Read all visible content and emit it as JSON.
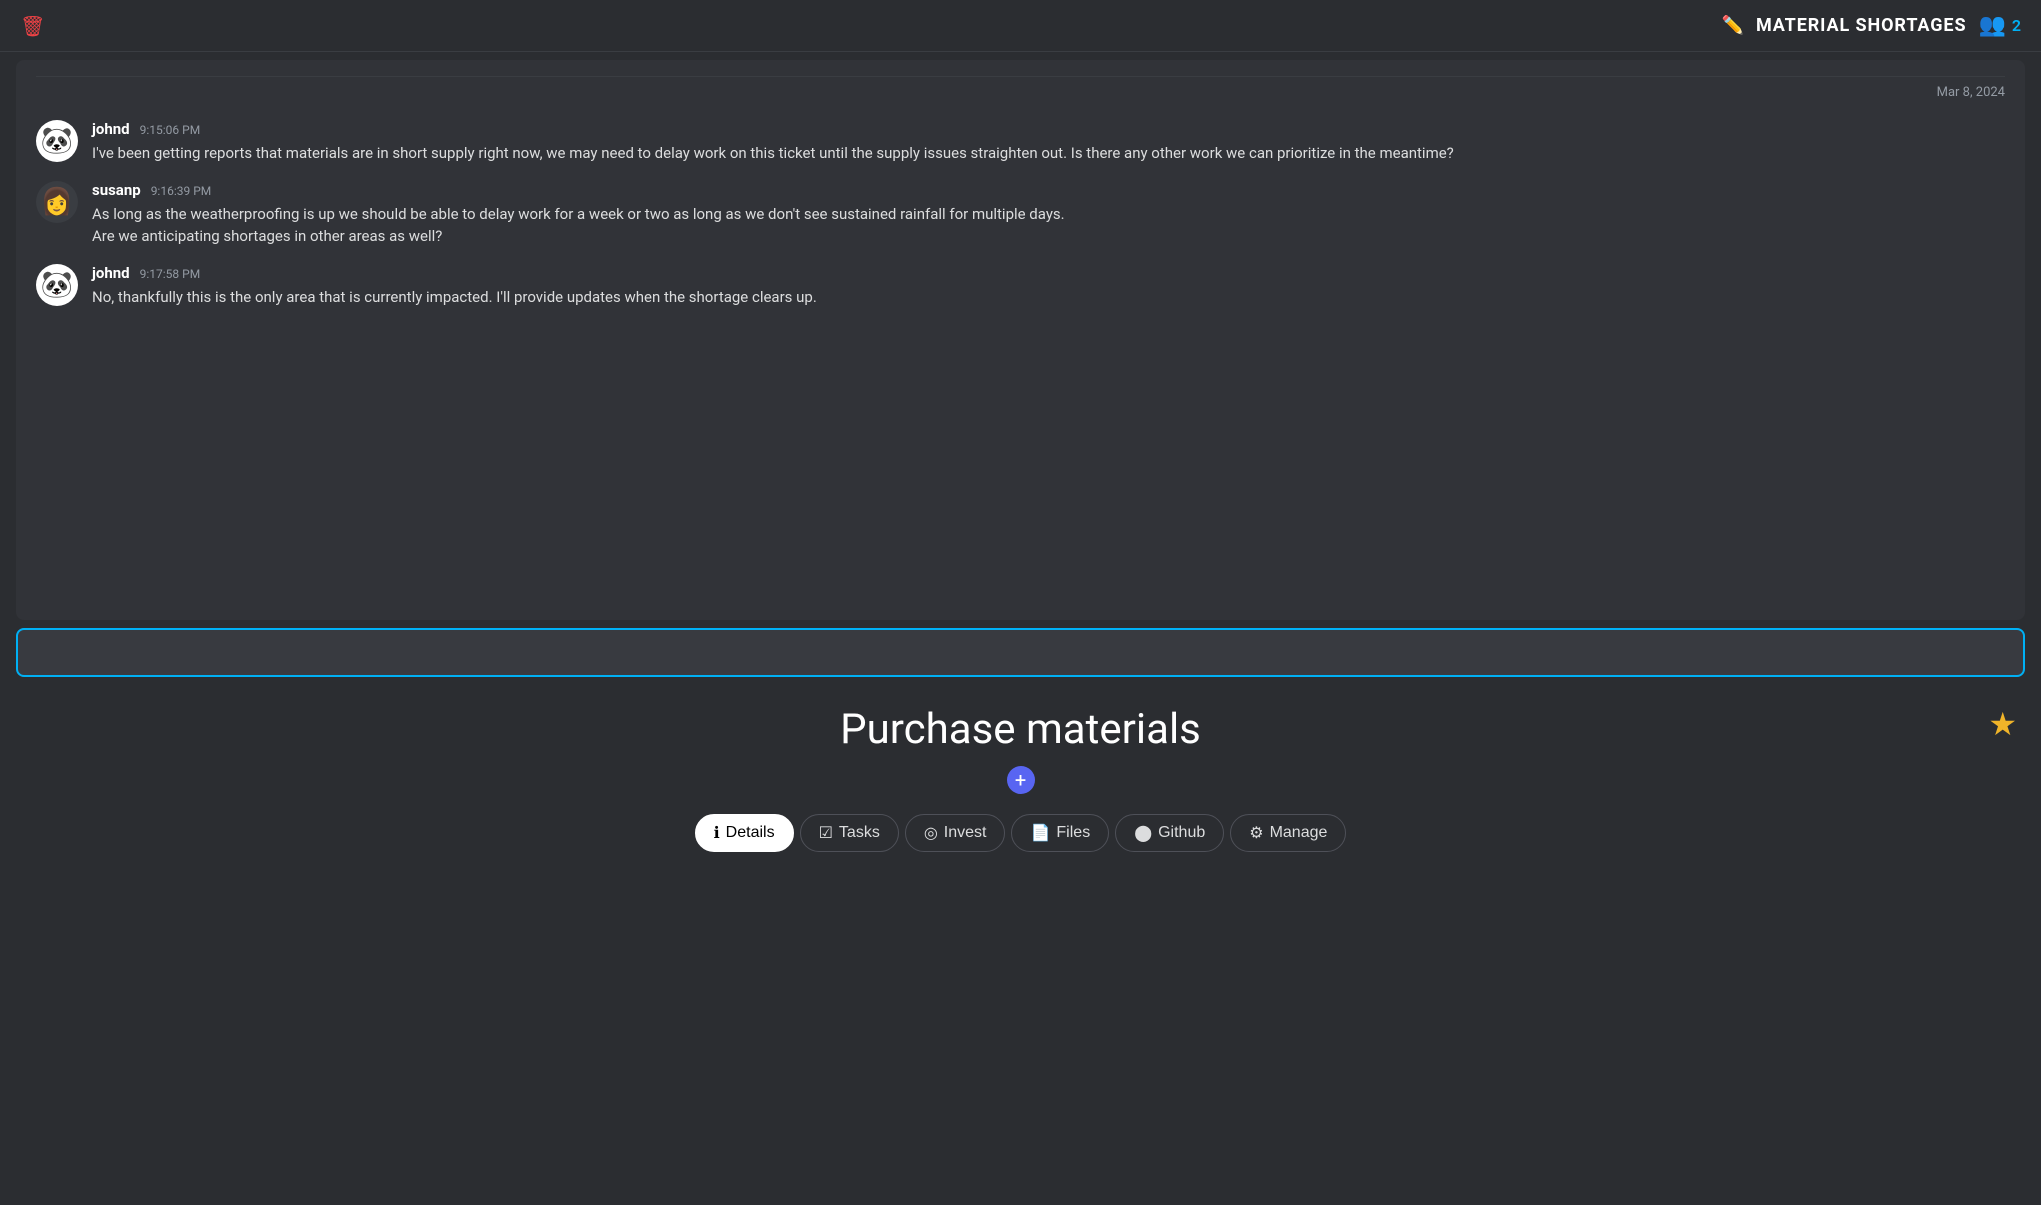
{
  "header": {
    "title": "MATERIAL SHORTAGES",
    "members_count": "2",
    "trash_label": "trash",
    "edit_label": "edit"
  },
  "chat": {
    "date": "Mar 8, 2024",
    "messages": [
      {
        "author": "johnd",
        "time": "9:15:06 PM",
        "avatar": "🐼",
        "text": "I've been getting reports that materials are in short supply right now, we may need to delay work on this ticket until the supply issues straighten out. Is there any other work we can prioritize in the meantime?"
      },
      {
        "author": "susanp",
        "time": "9:16:39 PM",
        "avatar": "👩",
        "text": "As long as the weatherproofing is up we should be able to delay work for a week or two as long as we don't see sustained rainfall for multiple days.\nAre we anticipating shortages in other areas as well?"
      },
      {
        "author": "johnd",
        "time": "9:17:58 PM",
        "avatar": "🐼",
        "text": "No, thankfully this is the only area that is currently impacted. I'll provide updates when the shortage clears up."
      }
    ]
  },
  "input": {
    "placeholder": ""
  },
  "bottom_panel": {
    "title": "Purchase materials",
    "plus_label": "+",
    "star_label": "★",
    "tabs": [
      {
        "id": "details",
        "icon": "ℹ",
        "label": "Details",
        "active": true
      },
      {
        "id": "tasks",
        "icon": "☑",
        "label": "Tasks",
        "active": false
      },
      {
        "id": "invest",
        "icon": "◎",
        "label": "Invest",
        "active": false
      },
      {
        "id": "files",
        "icon": "📄",
        "label": "Files",
        "active": false
      },
      {
        "id": "github",
        "icon": "⬤",
        "label": "Github",
        "active": false
      },
      {
        "id": "manage",
        "icon": "⚙",
        "label": "Manage",
        "active": false
      }
    ]
  }
}
